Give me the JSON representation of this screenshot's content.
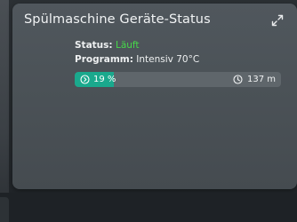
{
  "card": {
    "title": "Spülmaschine Geräte-Status",
    "expand_icon": "expand-arrows-icon"
  },
  "info": {
    "status_key": "Status:",
    "status_value": "Läuft",
    "program_key": "Programm:",
    "program_value": "Intensiv 70°C"
  },
  "progress": {
    "percent_label": "19 %",
    "percent_value": 19,
    "progress_icon": "progress-circle-icon",
    "time_label": "137 m",
    "time_icon": "clock-icon"
  },
  "colors": {
    "accent": "#1aa98d",
    "status_running": "#47d94a",
    "card_bg": "#4b5257"
  }
}
